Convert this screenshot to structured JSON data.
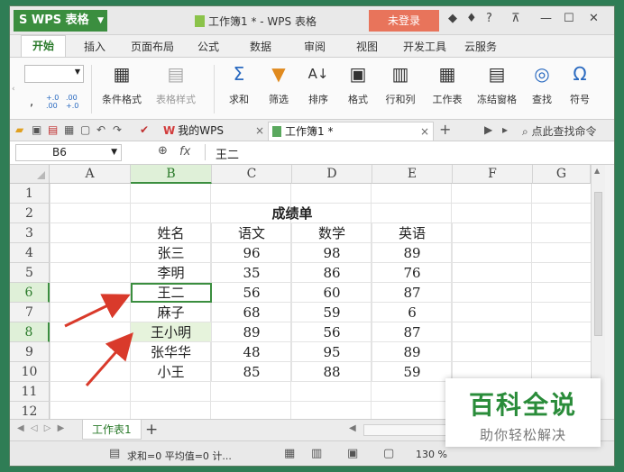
{
  "titlebar": {
    "app_name": "WPS 表格",
    "doc_title": "工作簿1 * - WPS 表格",
    "login_button": "未登录",
    "help": "?"
  },
  "menu": {
    "tabs": [
      "开始",
      "插入",
      "页面布局",
      "公式",
      "数据",
      "审阅",
      "视图",
      "开发工具",
      "云服务"
    ]
  },
  "ribbon": {
    "cond_format": "条件格式",
    "table_style": "表格样式",
    "sum": "求和",
    "filter": "筛选",
    "sort": "排序",
    "format": "格式",
    "rowcol": "行和列",
    "worksheet": "工作表",
    "freeze": "冻结窗格",
    "find": "查找",
    "symbol": "符号",
    "dec_inc": "+.0 .00",
    "dec_dec": ".00 +.0"
  },
  "doc_tabs": {
    "wps_tab": "我的WPS",
    "book_tab": "工作簿1 *",
    "search_cmd": "点此查找命令"
  },
  "formula_bar": {
    "name_box": "B6",
    "fx": "fx",
    "value": "王二"
  },
  "columns": [
    "A",
    "B",
    "C",
    "D",
    "E",
    "F",
    "G"
  ],
  "rows": [
    "1",
    "2",
    "3",
    "4",
    "5",
    "6",
    "7",
    "8",
    "9",
    "10",
    "11",
    "12"
  ],
  "sheet": {
    "title": "成绩单",
    "headers": [
      "姓名",
      "语文",
      "数学",
      "英语"
    ],
    "records": [
      [
        "张三",
        "96",
        "98",
        "89"
      ],
      [
        "李明",
        "35",
        "86",
        "76"
      ],
      [
        "王二",
        "56",
        "60",
        "87"
      ],
      [
        "麻子",
        "68",
        "59",
        "6"
      ],
      [
        "王小明",
        "89",
        "56",
        "87"
      ],
      [
        "张华华",
        "48",
        "95",
        "89"
      ],
      [
        "小王",
        "85",
        "88",
        "59"
      ]
    ]
  },
  "sheet_tabs": {
    "nav": "◀ ◁ ▷ ▶",
    "sheet1": "工作表1",
    "add": "+"
  },
  "status": {
    "text": "求和=0 平均值=0 计...",
    "zoom": "130 %"
  },
  "watermark": {
    "title": "百科全说",
    "subtitle": "助你轻松解决"
  },
  "colors": {
    "accent": "#3b8e3f",
    "login": "#e8745b",
    "arrow": "#d93a2b"
  }
}
